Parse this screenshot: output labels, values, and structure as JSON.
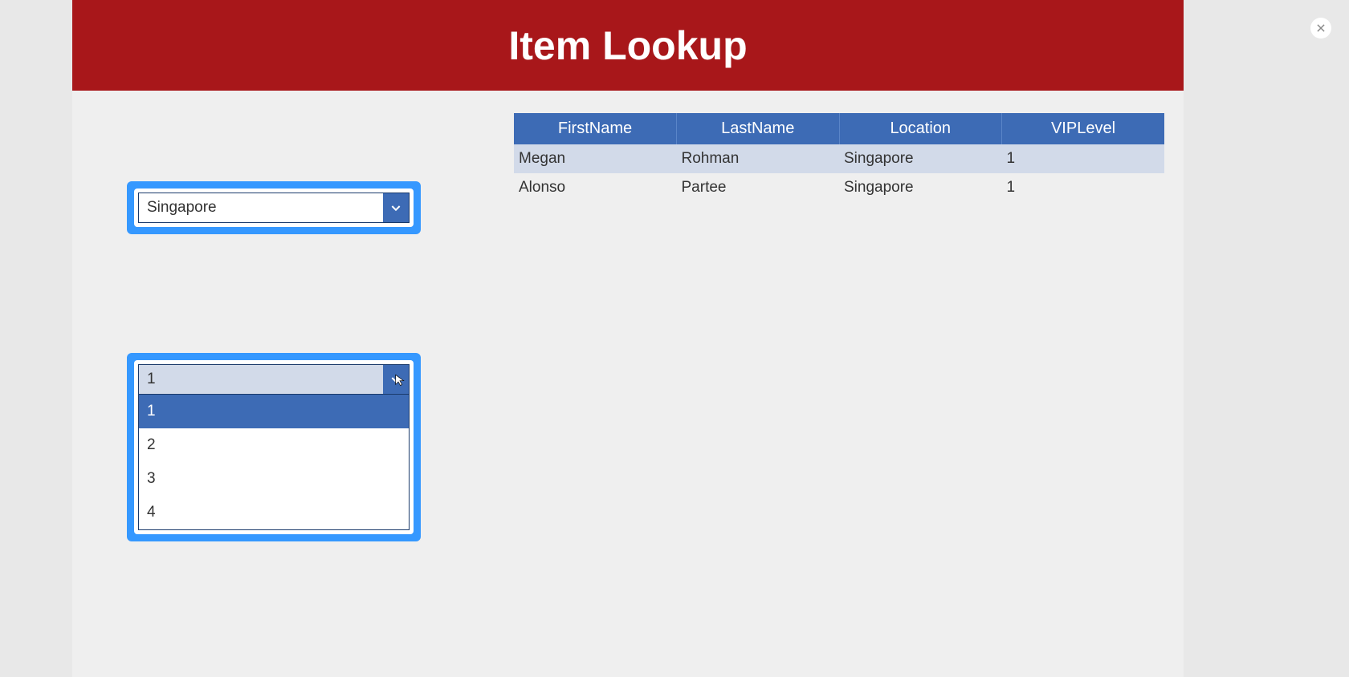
{
  "header": {
    "title": "Item Lookup"
  },
  "closeButton": {
    "iconName": "close-icon"
  },
  "location_dropdown": {
    "selected": "Singapore"
  },
  "viplevel_dropdown": {
    "selected": "1",
    "options": [
      "1",
      "2",
      "3",
      "4"
    ]
  },
  "table": {
    "columns": [
      "FirstName",
      "LastName",
      "Location",
      "VIPLevel"
    ],
    "rows": [
      {
        "first": "Megan",
        "last": "Rohman",
        "loc": "Singapore",
        "vip": "1"
      },
      {
        "first": "Alonso",
        "last": "Partee",
        "loc": "Singapore",
        "vip": "1"
      }
    ]
  }
}
